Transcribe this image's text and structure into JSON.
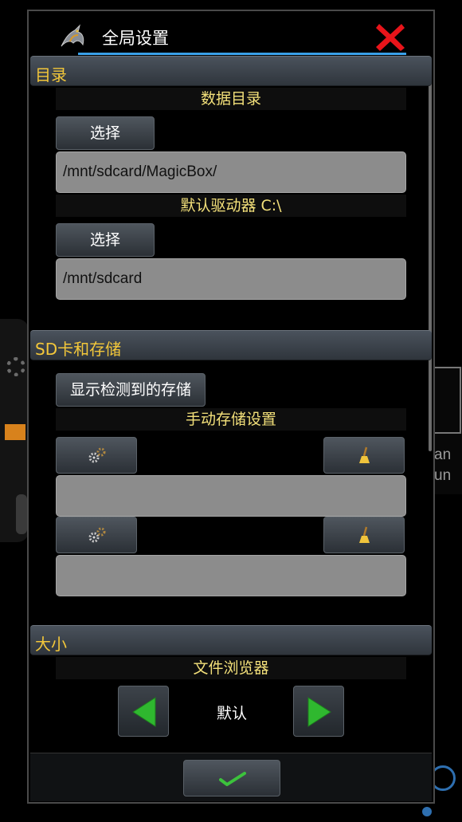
{
  "dialog": {
    "title": "全局设置",
    "icons": {
      "logo": "dragon-logo-icon",
      "close": "close-x-icon"
    },
    "close_color": "#e8141a"
  },
  "sections": {
    "directory": {
      "header": "目录",
      "data_dir_label": "数据目录",
      "data_dir_button": "选择",
      "data_dir_value": "/mnt/sdcard/MagicBox/",
      "drive_c_label": "默认驱动器 C:\\",
      "drive_c_button": "选择",
      "drive_c_value": "/mnt/sdcard"
    },
    "storage": {
      "header": "SD卡和存储",
      "show_detected_button": "显示检测到的存储",
      "manual_label": "手动存储设置",
      "slots": [
        {
          "value": "",
          "config_icon": "gears-icon",
          "clear_icon": "broom-icon"
        },
        {
          "value": "",
          "config_icon": "gears-icon",
          "clear_icon": "broom-icon"
        }
      ]
    },
    "size": {
      "header": "大小",
      "file_browser_label": "文件浏览器",
      "value": "默认",
      "prev_icon": "arrow-left-icon",
      "next_icon": "arrow-right-icon"
    }
  },
  "footer": {
    "confirm_icon": "checkmark-icon"
  },
  "background": {
    "line1": "an",
    "line2": "un"
  },
  "colors": {
    "accent_yellow": "#f3c73a",
    "title_underline": "#3aa0e8",
    "arrow_green": "#2fb82f",
    "check_green": "#3cc23c"
  }
}
